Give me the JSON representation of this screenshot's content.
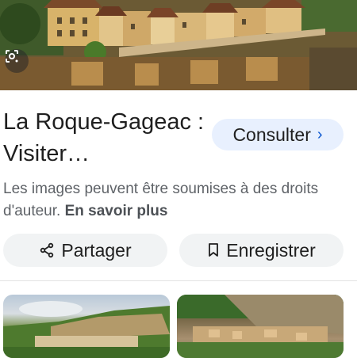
{
  "result": {
    "title": "La Roque-Gageac : Visiter…",
    "consult_label": "Consulter",
    "rights_text": "Les images peuvent être soumises à des droits d'auteur.",
    "learn_more_label": "En savoir plus",
    "share_label": "Partager",
    "save_label": "Enregistrer"
  },
  "icons": {
    "lens": "google-lens-icon",
    "consult_chevron": "chevron-right-icon",
    "share": "share-icon",
    "bookmark": "bookmark-icon"
  },
  "colors": {
    "consult_bg": "#e8f0fe",
    "accent": "#0b57d0",
    "pill_bg": "#f1f3f4",
    "muted_text": "#5f6368"
  }
}
